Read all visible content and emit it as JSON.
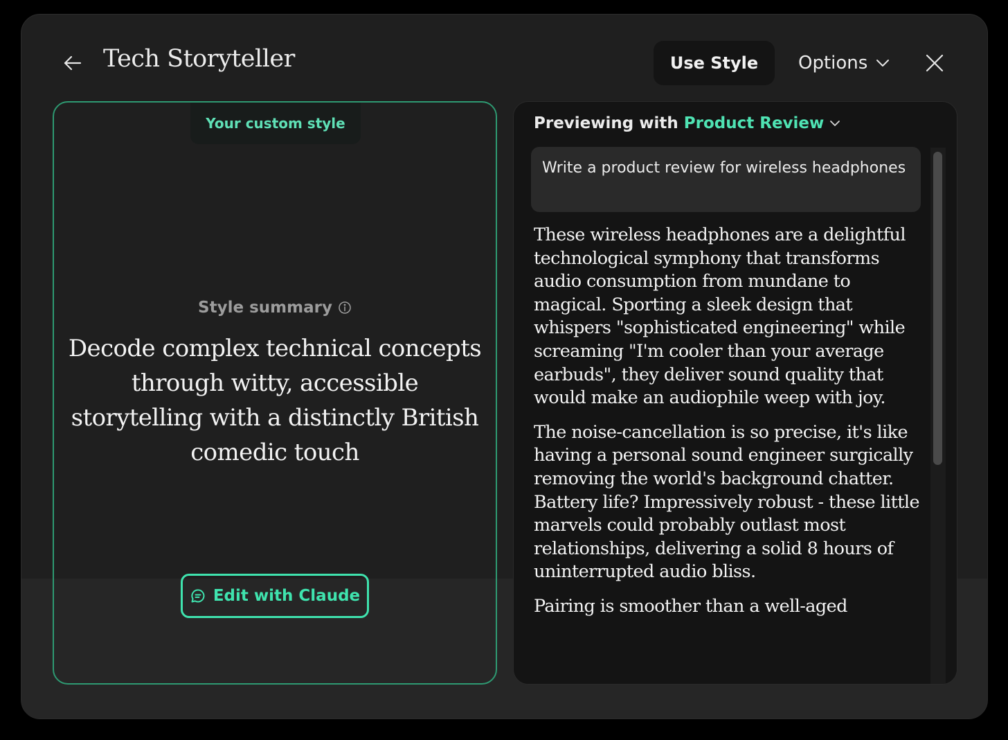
{
  "header": {
    "title": "Tech Storyteller",
    "use_style_label": "Use Style",
    "options_label": "Options"
  },
  "left_panel": {
    "badge": "Your custom style",
    "summary_label": "Style summary",
    "summary_text": "Decode complex technical concepts through witty, accessible storytelling with a distinctly British comedic touch",
    "edit_button_label": "Edit with Claude"
  },
  "preview": {
    "label": "Previewing with",
    "selected_style": "Product Review",
    "prompt": "Write a product review for wireless headphones",
    "paragraphs": [
      "These wireless headphones are a delightful technological symphony that transforms audio consumption from mundane to magical. Sporting a sleek design that whispers \"sophisticated engineering\" while screaming \"I'm cooler than your average earbuds\", they deliver sound quality that would make an audiophile weep with joy.",
      "The noise-cancellation is so precise, it's like having a personal sound engineer surgically removing the world's background chatter. Battery life? Impressively robust - these little marvels could probably outlast most relationships, delivering a solid 8 hours of uninterrupted audio bliss.",
      "Pairing is smoother than a well-aged"
    ]
  },
  "colors": {
    "accent": "#3fe3ae",
    "panel_border": "#2e9a72",
    "background": "#1f1f1f"
  },
  "icons": {
    "back": "arrow-left-icon",
    "close": "close-icon",
    "options": "chevron-down-icon",
    "info": "info-icon",
    "edit": "chat-bubble-icon"
  }
}
